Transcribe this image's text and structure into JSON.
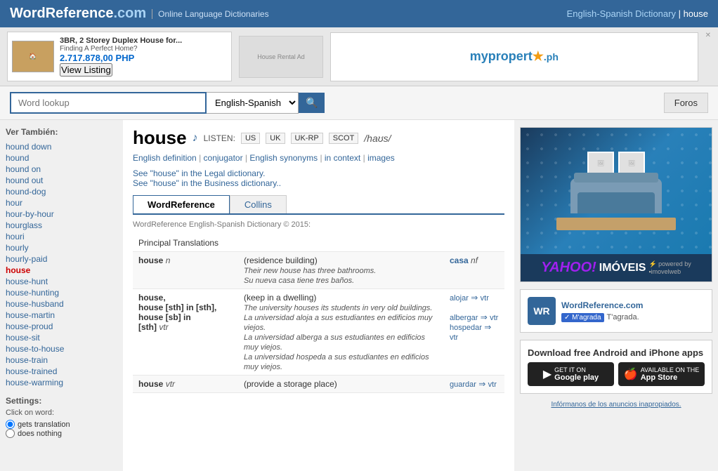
{
  "header": {
    "site_name": "WordReference",
    "site_com": ".com",
    "separator": " | ",
    "tagline": "Online Language Dictionaries",
    "dict_info": "English-Spanish Dictionary | house",
    "dict_link": "English-Spanish Dictionary",
    "current_word": "house"
  },
  "ad": {
    "house_ad_title": "3BR, 2 Storey Duplex House for...",
    "house_ad_sub": "Finding A Perfect Home?",
    "house_ad_price": "2.717.878,00 PHP",
    "house_ad_btn": "View Listing",
    "close_label": "✕",
    "myproperty_text": "mypropert★.ph"
  },
  "search": {
    "placeholder": "Word lookup",
    "lang_option": "English-Spanish",
    "search_icon": "🔍",
    "foros_label": "Foros"
  },
  "sidebar": {
    "ver_tambien": "Ver También:",
    "links": [
      {
        "label": "hound down",
        "href": "#",
        "active": false
      },
      {
        "label": "hound",
        "href": "#",
        "active": false
      },
      {
        "label": "hound on",
        "href": "#",
        "active": false
      },
      {
        "label": "hound out",
        "href": "#",
        "active": false
      },
      {
        "label": "hound-dog",
        "href": "#",
        "active": false
      },
      {
        "label": "hour",
        "href": "#",
        "active": false
      },
      {
        "label": "hour-by-hour",
        "href": "#",
        "active": false
      },
      {
        "label": "hourglass",
        "href": "#",
        "active": false
      },
      {
        "label": "houri",
        "href": "#",
        "active": false
      },
      {
        "label": "hourly",
        "href": "#",
        "active": false
      },
      {
        "label": "hourly-paid",
        "href": "#",
        "active": false
      },
      {
        "label": "house",
        "href": "#",
        "active": true
      },
      {
        "label": "house-hunt",
        "href": "#",
        "active": false
      },
      {
        "label": "house-hunting",
        "href": "#",
        "active": false
      },
      {
        "label": "house-husband",
        "href": "#",
        "active": false
      },
      {
        "label": "house-martin",
        "href": "#",
        "active": false
      },
      {
        "label": "house-proud",
        "href": "#",
        "active": false
      },
      {
        "label": "house-sit",
        "href": "#",
        "active": false
      },
      {
        "label": "house-to-house",
        "href": "#",
        "active": false
      },
      {
        "label": "house-train",
        "href": "#",
        "active": false
      },
      {
        "label": "house-trained",
        "href": "#",
        "active": false
      },
      {
        "label": "house-warming",
        "href": "#",
        "active": false
      }
    ],
    "settings_label": "Settings:",
    "click_on_word": "Click on word:",
    "radio_options": [
      {
        "label": "gets translation",
        "value": "translation",
        "checked": true
      },
      {
        "label": "does nothing",
        "value": "nothing",
        "checked": false
      }
    ]
  },
  "word": {
    "title": "house",
    "audio_icon": "♪",
    "listen_label": "LISTEN:",
    "pron_btns": [
      "US",
      "UK",
      "UK-RP",
      "SCOT"
    ],
    "phonetic": "/haʊs/",
    "links": [
      {
        "label": "English definition",
        "href": "#"
      },
      {
        "sep": " | "
      },
      {
        "label": "conjugator",
        "href": "#"
      },
      {
        "sep": " | "
      },
      {
        "label": "English synonyms",
        "href": "#"
      },
      {
        "sep": " | "
      },
      {
        "label": "in context",
        "href": "#"
      },
      {
        "sep": " | "
      },
      {
        "label": "images",
        "href": "#"
      }
    ],
    "dict_links": [
      {
        "label": "See \"house\" in the Legal dictionary.",
        "href": "#"
      },
      {
        "label": "See \"house\" in the Business dictionary..",
        "href": "#"
      }
    ]
  },
  "tabs": [
    {
      "label": "WordReference",
      "active": true
    },
    {
      "label": "Collins",
      "active": false
    }
  ],
  "copyright": "WordReference English-Spanish Dictionary © 2015:",
  "table": {
    "section_header": "Principal Translations",
    "columns": [
      "",
      "",
      ""
    ],
    "rows": [
      {
        "type": "entry",
        "word": "house",
        "pos": "n",
        "definition": "(residence building)",
        "example_en": "Their new house has three bathrooms.",
        "example_sp": "Su nueva casa tiene tres baños.",
        "translation": "casa",
        "trans_pos": "nf",
        "trans_link": ""
      },
      {
        "type": "entry",
        "word": "house, house [sth] in [sth], house [sb] in [sth]",
        "pos": "vtr",
        "definition": "(keep in a dwelling)",
        "example_en": "",
        "example_sp": "",
        "translation": "alojar",
        "trans_link": "vtr",
        "trans2": "albergar",
        "trans2_link": "vtr",
        "trans3": "hospedar",
        "trans3_link": "vtr",
        "example_en2": "The university houses its students in very old buildings.",
        "example_sp2": "La universidad aloja a sus estudiantes en edificios muy viejos.",
        "example_sp3": "La universidad alberga a sus estudiantes en edificios muy viejos.",
        "example_sp4": "La universidad hospeda a sus estudiantes en edificios muy viejos."
      },
      {
        "type": "entry",
        "word": "house",
        "pos": "vtr",
        "definition": "(provide a storage place)",
        "translation": "guardar",
        "trans_link": "vtr"
      }
    ]
  },
  "right_sidebar": {
    "wr_site_name": "WordReference.com",
    "wr_logo": "WR",
    "tagrada_label": "✓ M'agrada",
    "tagrada_text": "T'agrada.",
    "app_download_title": "Download free Android and iPhone apps",
    "google_play_label": "GET IT ON",
    "google_play_store": "Google play",
    "apple_label": "AVAILABLE ON THE",
    "apple_store": "App Store",
    "ad_report": "Infórmanos de los anuncios inapropiados."
  }
}
